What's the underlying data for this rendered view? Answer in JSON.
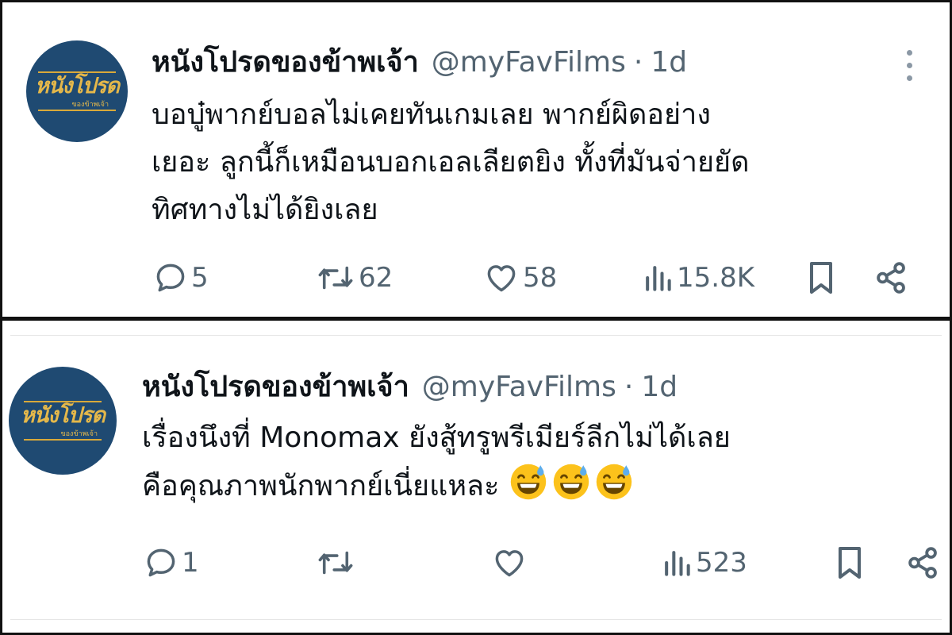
{
  "tweets": [
    {
      "avatar": {
        "title": "หนังโปรด",
        "subtitle": "ของข้าพเจ้า"
      },
      "name": "หนังโปรดของข้าพเจ้า",
      "handle": "@myFavFilms",
      "separator": "·",
      "time": "1d",
      "text_lines": [
        "บอบู๋พากย์บอลไม่เคยทันเกมเลย พากย์ผิดอย่าง",
        "เยอะ ลูกนี้ก็เหมือนบอกเอลเลียตยิง ทั้งที่มันจ่ายยัด",
        "ทิศทางไม่ได้ยิงเลย"
      ],
      "emojis": [],
      "replies": "5",
      "retweets": "62",
      "likes": "58",
      "views": "15.8K"
    },
    {
      "avatar": {
        "title": "หนังโปรด",
        "subtitle": "ของข้าพเจ้า"
      },
      "name": "หนังโปรดของข้าพเจ้า",
      "handle": "@myFavFilms",
      "separator": "·",
      "time": "1d",
      "text_lines": [
        "เรื่องนึงที่ Monomax ยังสู้ทรูพรีเมียร์ลีกไม่ได้เลย",
        "คือคุณภาพนักพากย์เนี่ยแหละ"
      ],
      "emojis": [
        "grinning-face-with-sweat",
        "grinning-face-with-sweat",
        "grinning-face-with-sweat"
      ],
      "replies": "1",
      "retweets": "",
      "likes": "",
      "views": "523"
    }
  ],
  "icons": {
    "reply": "reply-icon",
    "retweet": "retweet-icon",
    "like": "heart-icon",
    "views": "views-icon",
    "bookmark": "bookmark-icon",
    "share": "share-icon",
    "more": "more-vertical-icon"
  },
  "colors": {
    "avatar_bg": "#1f4a72",
    "avatar_text": "#e5b84a",
    "secondary_text": "#536471",
    "primary_text": "#0f1419"
  }
}
